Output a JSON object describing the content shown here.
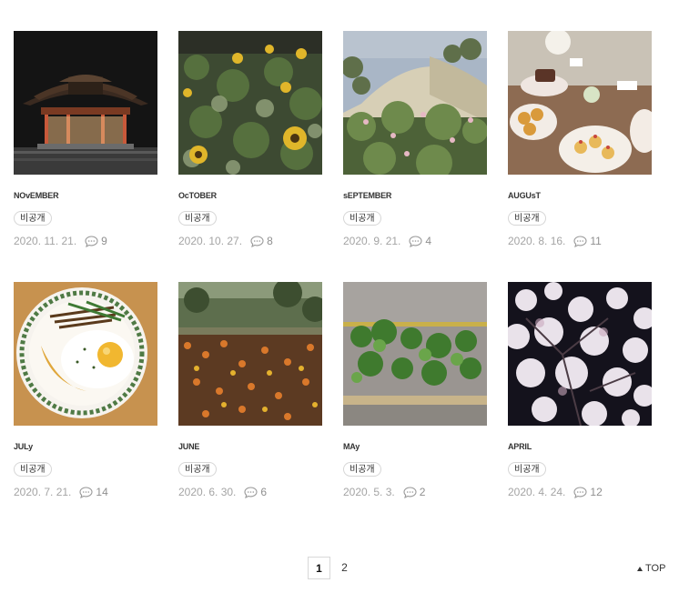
{
  "posts": [
    {
      "title": "NOvEMBER",
      "badge": "비공개",
      "date": "2020. 11. 21.",
      "comments": "9",
      "scene": "pavilion"
    },
    {
      "title": "OcTOBER",
      "badge": "비공개",
      "date": "2020. 10. 27.",
      "comments": "8",
      "scene": "sunflowers"
    },
    {
      "title": "sEPTEMBER",
      "badge": "비공개",
      "date": "2020. 9. 21.",
      "comments": "4",
      "scene": "dome"
    },
    {
      "title": "AUGUsT",
      "badge": "비공개",
      "date": "2020. 8. 16.",
      "comments": "11",
      "scene": "desserts"
    },
    {
      "title": "JULy",
      "badge": "비공개",
      "date": "2020. 7. 21.",
      "comments": "14",
      "scene": "egg-plate"
    },
    {
      "title": "JUNE",
      "badge": "비공개",
      "date": "2020. 6. 30.",
      "comments": "6",
      "scene": "flower-field"
    },
    {
      "title": "MAy",
      "badge": "비공개",
      "date": "2020. 5. 3.",
      "comments": "2",
      "scene": "garden-bed"
    },
    {
      "title": "APRIL",
      "badge": "비공개",
      "date": "2020. 4. 24.",
      "comments": "12",
      "scene": "blossoms"
    }
  ],
  "pagination": {
    "pages": [
      "1",
      "2"
    ],
    "current": "1"
  },
  "top_link": {
    "label": "TOP",
    "icon": "triangle-up-icon"
  }
}
